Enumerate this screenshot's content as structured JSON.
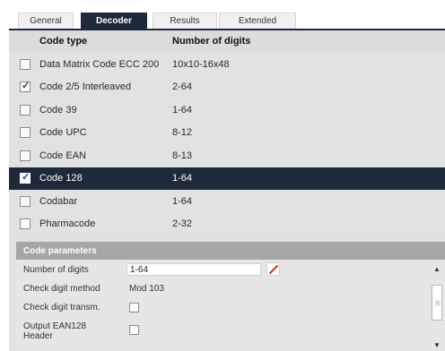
{
  "tabs": [
    {
      "label": "General",
      "active": false
    },
    {
      "label": "Decoder",
      "active": true
    },
    {
      "label": "Results",
      "active": false
    },
    {
      "label": "Extended",
      "active": false
    }
  ],
  "table": {
    "headers": {
      "code_type": "Code type",
      "digits": "Number of digits"
    },
    "rows": [
      {
        "name": "Data Matrix Code ECC 200",
        "digits": "10x10-16x48",
        "checked": false,
        "selected": false
      },
      {
        "name": "Code 2/5 Interleaved",
        "digits": "2-64",
        "checked": true,
        "selected": false
      },
      {
        "name": "Code 39",
        "digits": "1-64",
        "checked": false,
        "selected": false
      },
      {
        "name": "Code UPC",
        "digits": "8-12",
        "checked": false,
        "selected": false
      },
      {
        "name": "Code EAN",
        "digits": "8-13",
        "checked": false,
        "selected": false
      },
      {
        "name": "Code 128",
        "digits": "1-64",
        "checked": true,
        "selected": true
      },
      {
        "name": "Codabar",
        "digits": "1-64",
        "checked": false,
        "selected": false
      },
      {
        "name": "Pharmacode",
        "digits": "2-32",
        "checked": false,
        "selected": false
      }
    ]
  },
  "params": {
    "title": "Code parameters",
    "number_of_digits_label": "Number of digits",
    "number_of_digits_value": "1-64",
    "check_digit_method_label": "Check digit method",
    "check_digit_method_value": "Mod 103",
    "check_digit_transm_label": "Check digit transm.",
    "check_digit_transm_checked": false,
    "output_ean128_label_line1": "Output EAN128",
    "output_ean128_label_line2": "Header",
    "output_ean128_checked": false
  },
  "icons": {
    "edit": "pencil-icon",
    "scroll_up": "arrow-up-icon",
    "scroll_down": "arrow-down-icon"
  },
  "colors": {
    "accent_dark": "#1e2a3a",
    "panel_bg": "#e1e1e1",
    "section_header": "#a6a6a6",
    "checkmark": "#1e3f8c",
    "pencil": "#c0392b"
  }
}
